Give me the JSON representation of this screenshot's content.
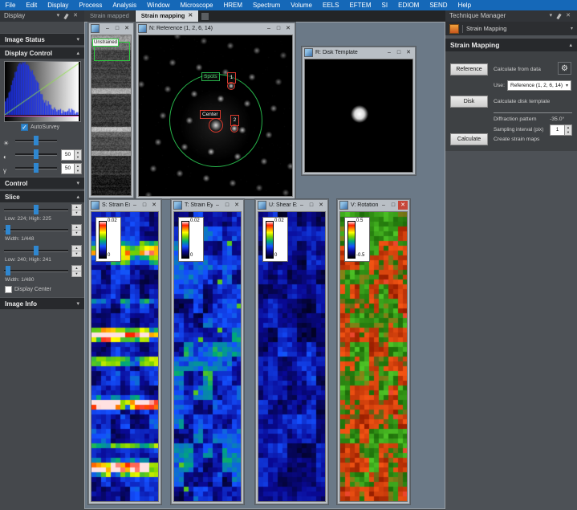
{
  "chrome": {
    "minimize": "–",
    "maximize": "□",
    "close": "✕",
    "collapsed_arrow": "▾",
    "expanded_arrow": "▴",
    "dropdown_arrow": "▾",
    "up": "▲",
    "down": "▼",
    "check": "✓"
  },
  "colors": {
    "menubar": "#1568b8",
    "accent": "#2f87d0",
    "workspace": "#6b7987",
    "annotation_green": "#27b34a",
    "annotation_red": "#d63a2e"
  },
  "menu": {
    "items": [
      "File",
      "Edit",
      "Display",
      "Process",
      "Analysis",
      "Window",
      "Microscope",
      "HREM",
      "Spectrum",
      "Volume",
      "EELS",
      "EFTEM",
      "SI",
      "EDIOM",
      "SEND",
      "Help"
    ]
  },
  "display_panel": {
    "title": "Display",
    "image_status_header": "Image Status",
    "display_control_header": "Display Control",
    "control_header": "Control",
    "slice_header": "Slice",
    "image_info_header": "Image Info",
    "display_control": {
      "auto_survey_label": "AutoSurvey",
      "auto_survey_checked": true,
      "sliders": [
        {
          "icon": "brightness",
          "glyph": "☀",
          "value": "50"
        },
        {
          "icon": "contrast",
          "glyph": "◐",
          "value": "50"
        },
        {
          "icon": "gamma",
          "glyph": "γ",
          "value": "50"
        }
      ]
    },
    "slice": {
      "low_high_1": "Low: 224; High: 225",
      "width_1": "Width: 1/448",
      "low_high_2": "Low: 240; High: 241",
      "width_2": "Width: 1/480",
      "display_center_label": "Display Center"
    }
  },
  "tabs": {
    "inactive": "Strain mapped",
    "active": "Strain mapping"
  },
  "windows": {
    "survey": {
      "annotation": "Unstrained"
    },
    "reference": {
      "title": "N: Reference (1, 2, 6, 14)",
      "spots_label": "Spots",
      "center_label": "Center",
      "marker1": "1",
      "marker2": "2"
    },
    "disk": {
      "title": "R: Disk Template"
    },
    "strain_maps": [
      {
        "title": "S: Strain Exx",
        "max": "0.02",
        "min": "0"
      },
      {
        "title": "T: Strain Eyy",
        "max": "0.02",
        "min": "0"
      },
      {
        "title": "U: Shear Exy",
        "max": "0.02",
        "min": "0"
      },
      {
        "title": "V: Rotation (...",
        "max": "0.5",
        "min": "-0.5"
      }
    ]
  },
  "technique_panel": {
    "title": "Technique Manager",
    "technique_selector": "Strain Mapping",
    "section_header": "Strain Mapping",
    "reference_button": "Reference",
    "reference_desc": "Calculate from data",
    "use_label": "Use:",
    "use_value": "Reference (1, 2, 6, 14)",
    "disk_button": "Disk",
    "disk_desc": "Calculate disk template",
    "diffraction_label": "Diffraction pattern",
    "diffraction_value": "-35.0°",
    "sampling_label": "Sampling interval (pix)",
    "sampling_value": "1",
    "calculate_button": "Calculate",
    "calculate_desc": "Create strain maps"
  }
}
